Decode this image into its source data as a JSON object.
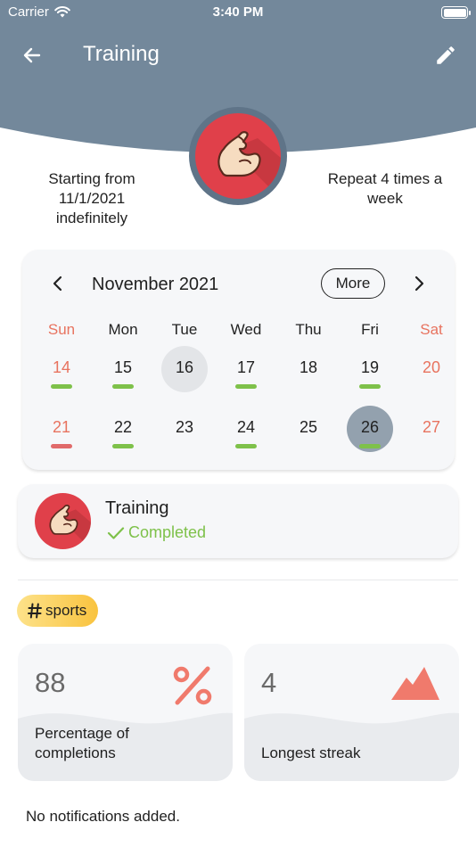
{
  "status_bar": {
    "carrier": "Carrier",
    "time": "3:40 PM"
  },
  "nav": {
    "title": "Training",
    "back_icon": "arrow-left-icon",
    "edit_icon": "pencil-icon"
  },
  "colors": {
    "header": "#73889b",
    "accent_red": "#e0404a",
    "weekend": "#e8735f",
    "done_green": "#7ec14a",
    "missed_red": "#e06a6a",
    "card_bg": "#f6f7f9"
  },
  "schedule": {
    "start": "Starting from 11/1/2021 indefinitely",
    "repeat": "Repeat 4 times a week"
  },
  "calendar": {
    "month_label": "November 2021",
    "more_label": "More",
    "weekdays": [
      "Sun",
      "Mon",
      "Tue",
      "Wed",
      "Thu",
      "Fri",
      "Sat"
    ],
    "weeks": [
      [
        {
          "day": "14",
          "mark": "green"
        },
        {
          "day": "15",
          "mark": "green"
        },
        {
          "day": "16",
          "mark": "",
          "state": "today"
        },
        {
          "day": "17",
          "mark": "green"
        },
        {
          "day": "18",
          "mark": ""
        },
        {
          "day": "19",
          "mark": "green"
        },
        {
          "day": "20",
          "mark": ""
        }
      ],
      [
        {
          "day": "21",
          "mark": "red"
        },
        {
          "day": "22",
          "mark": "green"
        },
        {
          "day": "23",
          "mark": ""
        },
        {
          "day": "24",
          "mark": "green"
        },
        {
          "day": "25",
          "mark": ""
        },
        {
          "day": "26",
          "mark": "green",
          "state": "selected"
        },
        {
          "day": "27",
          "mark": ""
        }
      ]
    ]
  },
  "habit": {
    "name": "Training",
    "status": "Completed",
    "icon": "flexed-biceps-icon"
  },
  "tag": {
    "label": "sports"
  },
  "stats": [
    {
      "value": "88",
      "label": "Percentage of completions",
      "icon": "percent-icon"
    },
    {
      "value": "4",
      "label": "Longest streak",
      "icon": "mountain-icon"
    }
  ],
  "notifications": {
    "empty_text": "No notifications added."
  }
}
